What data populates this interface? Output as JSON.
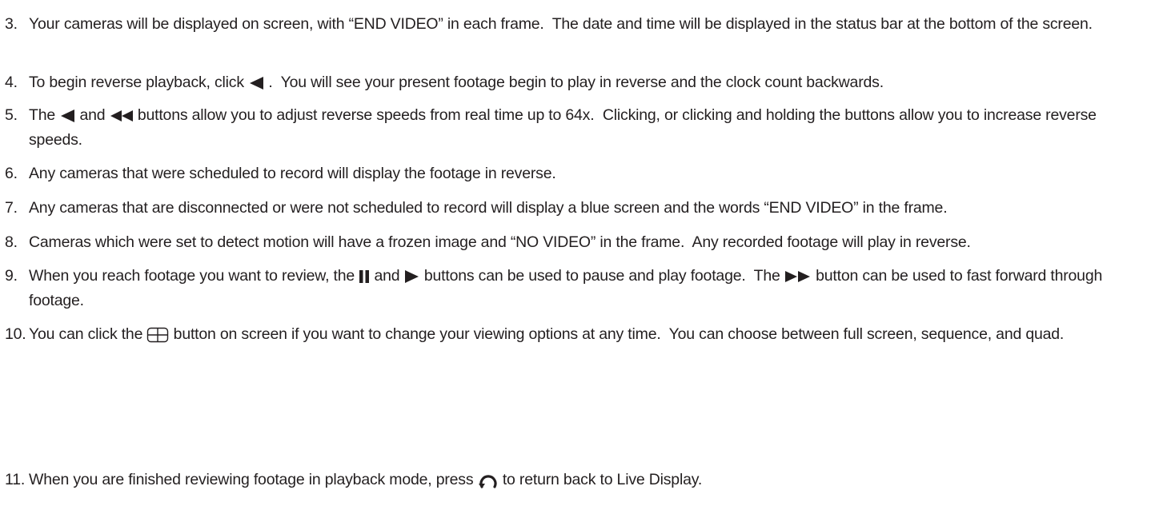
{
  "colors": {
    "text": "#231f20",
    "icon": "#231f20",
    "background": "#ffffff"
  },
  "items": [
    {
      "number": "3.",
      "parts": [
        "Your cameras will be displayed on screen, with “END VIDEO” in each frame.  The date and time will be displayed in the status bar at the bottom of the screen."
      ]
    },
    {
      "number": "4.",
      "parts": [
        "To begin reverse playback, click ",
        " .  You will see your present footage begin to play in reverse and the clock count backwards."
      ],
      "icons": [
        "reverse-play-icon"
      ]
    },
    {
      "number": "5.",
      "parts": [
        "The ",
        " and ",
        " buttons allow you to adjust reverse speeds from real time up to 64x.  Clicking, or clicking and holding the buttons allow you to increase reverse speeds."
      ],
      "icons": [
        "reverse-play-icon",
        "fast-reverse-icon"
      ]
    },
    {
      "number": "6.",
      "parts": [
        "Any cameras that were scheduled to record will display the footage in reverse."
      ]
    },
    {
      "number": "7.",
      "parts": [
        "Any cameras that are disconnected or were not scheduled to record will display a blue screen and the words “END VIDEO” in the frame."
      ]
    },
    {
      "number": "8.",
      "parts": [
        "Cameras which were set to detect motion will have a frozen image and “NO VIDEO” in the frame.  Any recorded footage will play in reverse."
      ]
    },
    {
      "number": "9.",
      "parts": [
        "When you reach footage you want to review, the ",
        " and ",
        " buttons can be used to pause and play footage.  The ",
        " button can be used to fast forward through footage."
      ],
      "icons": [
        "pause-icon",
        "play-icon",
        "fast-forward-icon"
      ]
    },
    {
      "number": "10.",
      "parts": [
        "You can click the ",
        " button on screen if you want to change your viewing options at any time.  You can choose between full screen, sequence, and quad."
      ],
      "icons": [
        "quad-view-icon"
      ]
    },
    {
      "number": "11.",
      "parts": [
        "When you are finished reviewing footage in playback mode, press ",
        " to return back to Live Display."
      ],
      "icons": [
        "return-icon"
      ]
    }
  ]
}
